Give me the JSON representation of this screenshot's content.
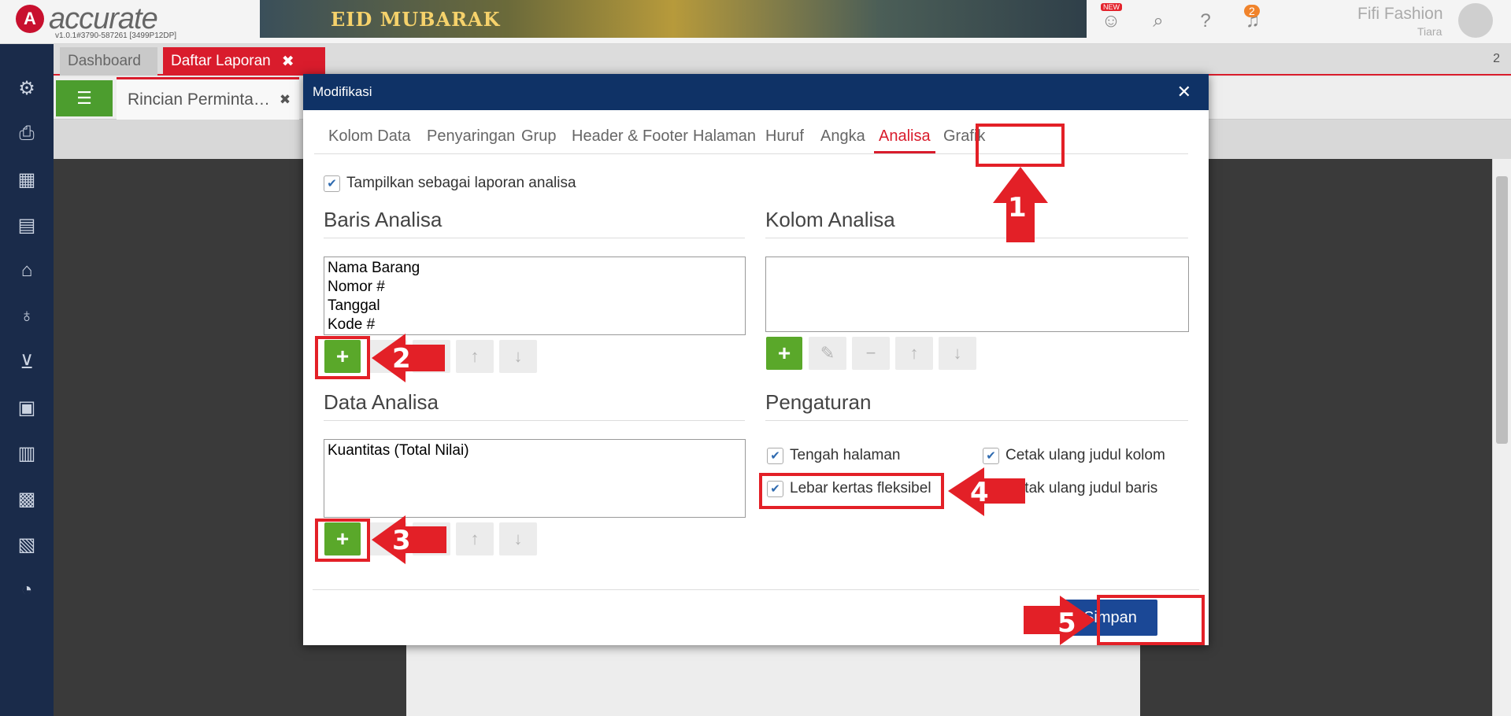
{
  "app": {
    "logo_text": "accurate",
    "logo_sub": "v1.0.1#3790-587261 [3499P12DP]",
    "banner_text": "EID MUBARAK",
    "user_name": "Fifi Fashion",
    "user_sub": "Tiara",
    "notif_count": "2",
    "new_badge": "NEW"
  },
  "tabs": {
    "dashboard": "Dashboard",
    "daftar": "Daftar Laporan",
    "close": "✖",
    "count": "2"
  },
  "subtabs": {
    "rincian": "Rincian Perminta…",
    "close": "✖"
  },
  "modal": {
    "title": "Modifikasi",
    "close": "✕",
    "tabs": [
      "Kolom Data",
      "Penyaringan",
      "Grup",
      "Header & Footer",
      "Halaman",
      "Huruf",
      "Angka",
      "Analisa",
      "Grafik"
    ],
    "active_tab": "Analisa",
    "show_as_analysis": "Tampilkan sebagai laporan analisa",
    "baris_title": "Baris Analisa",
    "baris_items": [
      "Nama Barang",
      "Nomor #",
      "Tanggal",
      "Kode #"
    ],
    "kolom_title": "Kolom Analisa",
    "data_title": "Data Analisa",
    "data_items": [
      "Kuantitas (Total Nilai)"
    ],
    "pengaturan_title": "Pengaturan",
    "opt_tengah": "Tengah halaman",
    "opt_cetak_kolom": "Cetak ulang judul kolom",
    "opt_lebar": "Lebar kertas fleksibel",
    "opt_cetak_baris": "Cetak ulang judul baris",
    "save": "Simpan"
  },
  "annotations": [
    "1",
    "2",
    "3",
    "4",
    "5"
  ],
  "colors": {
    "accent_red": "#d91c2c",
    "modal_header": "#0f3266",
    "add_green": "#5aa82a",
    "save_blue": "#1b4896",
    "annotation_red": "#e32027"
  }
}
